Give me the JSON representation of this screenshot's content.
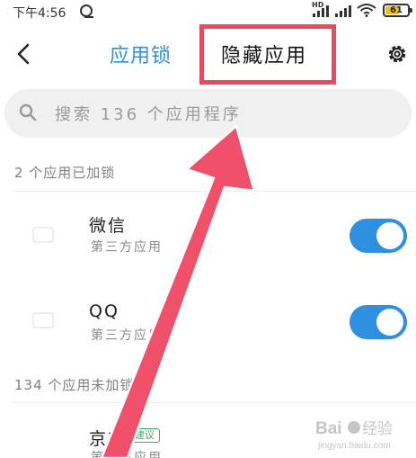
{
  "status_bar": {
    "time": "下午4:56",
    "network_label": "HD",
    "battery_level": "61",
    "battery_fraction": 0.61
  },
  "header": {
    "back_icon": "chevron-left-icon",
    "tab_app_lock": "应用锁",
    "tab_hidden_apps": "隐藏应用",
    "settings_icon": "gear-icon"
  },
  "search": {
    "icon": "search-icon",
    "placeholder": "搜索 136 个应用程序"
  },
  "locked_section": {
    "title": "2 个应用已加锁",
    "apps": [
      {
        "name": "微信",
        "category": "第三方应用",
        "locked": true
      },
      {
        "name": "QQ",
        "category": "第三方应用",
        "locked": true
      }
    ]
  },
  "unlocked_section": {
    "title": "134 个应用未加锁",
    "apps": [
      {
        "name": "京东",
        "badge": "建议",
        "category": "第三方应用"
      }
    ]
  },
  "annotation": {
    "highlight_color": "#e34b61",
    "arrow_color": "#f0506a"
  },
  "colors": {
    "accent": "#2f8fe0",
    "badge_green": "#34b25e"
  },
  "watermark": {
    "text": "Baidu 经验",
    "url_text": "jingyan.baidu.com"
  }
}
